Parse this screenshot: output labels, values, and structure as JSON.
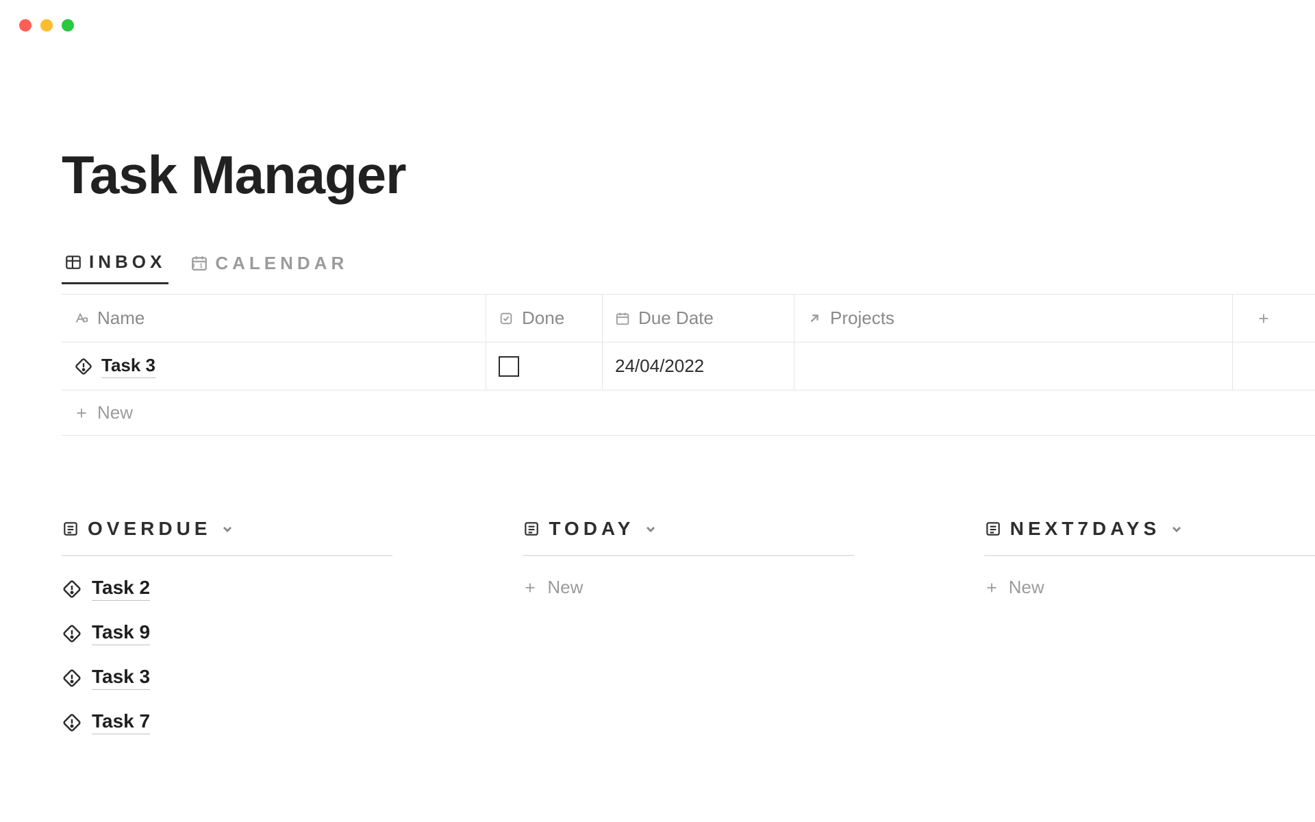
{
  "page": {
    "title": "Task Manager"
  },
  "tabs": {
    "inbox": "INBOX",
    "calendar": "CALENDAR"
  },
  "columns": {
    "name": "Name",
    "done": "Done",
    "due": "Due Date",
    "projects": "Projects"
  },
  "inbox_rows": [
    {
      "name": "Task 3",
      "done": false,
      "due": "24/04/2022",
      "projects": ""
    }
  ],
  "new_label": "New",
  "boards": {
    "overdue": {
      "title": "OVERDUE",
      "items": [
        "Task 2",
        "Task 9",
        "Task 3",
        "Task 7"
      ]
    },
    "today": {
      "title": "TODAY",
      "items": []
    },
    "next7days": {
      "title": "NEXT7DAYS",
      "items": []
    }
  }
}
